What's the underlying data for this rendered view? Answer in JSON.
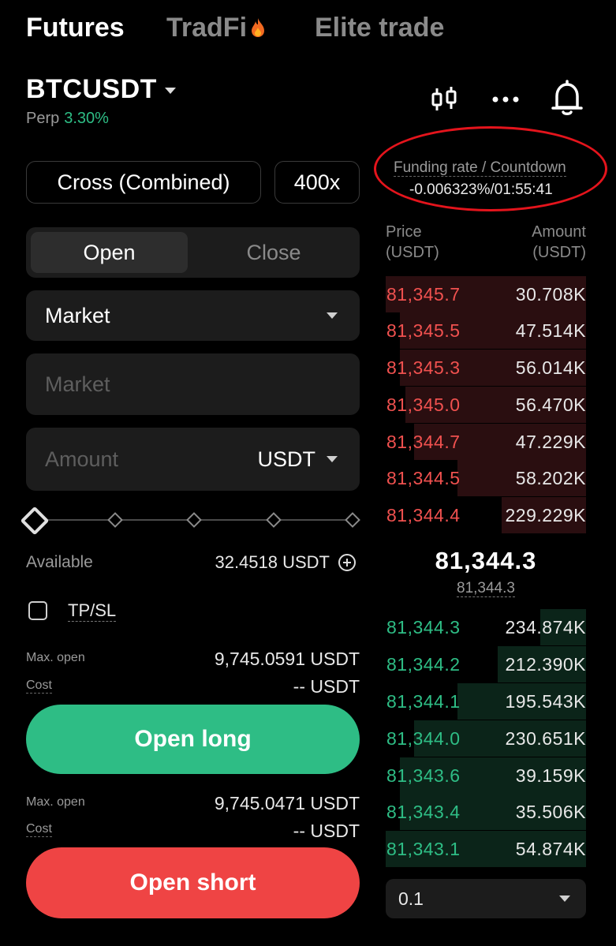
{
  "tabs": {
    "futures": "Futures",
    "tradfi": "TradFi",
    "elite": "Elite trade"
  },
  "header": {
    "symbol": "BTCUSDT",
    "perp_label": "Perp",
    "change": "3.30%"
  },
  "icons": {
    "chart": "candlestick-icon",
    "more": "more-icon",
    "bell": "bell-icon",
    "fire": "fire-icon"
  },
  "margin": {
    "mode": "Cross (Combined)",
    "leverage": "400x"
  },
  "funding": {
    "label": "Funding rate / Countdown",
    "value": "-0.006323%/01:55:41"
  },
  "order_tabs": {
    "open": "Open",
    "close": "Close"
  },
  "order_type": {
    "selected": "Market"
  },
  "price_field": {
    "placeholder": "Market"
  },
  "amount_field": {
    "placeholder": "Amount",
    "unit": "USDT"
  },
  "slider": {
    "fraction": 0
  },
  "available": {
    "label": "Available",
    "value": "32.4518 USDT"
  },
  "tpsl": {
    "label": "TP/SL",
    "checked": false
  },
  "long": {
    "max_label": "Max. open",
    "max_value": "9,745.0591 USDT",
    "cost_label": "Cost",
    "cost_value": "-- USDT",
    "button": "Open long"
  },
  "short": {
    "max_label": "Max. open",
    "max_value": "9,745.0471 USDT",
    "cost_label": "Cost",
    "cost_value": "-- USDT",
    "button": "Open short"
  },
  "orderbook": {
    "price_header": "Price",
    "price_unit": "(USDT)",
    "amount_header": "Amount",
    "amount_unit": "(USDT)",
    "asks": [
      {
        "price": "81,345.7",
        "amount": "30.708K",
        "depth": 1.0
      },
      {
        "price": "81,345.5",
        "amount": "47.514K",
        "depth": 0.93
      },
      {
        "price": "81,345.3",
        "amount": "56.014K",
        "depth": 0.93
      },
      {
        "price": "81,345.0",
        "amount": "56.470K",
        "depth": 0.9
      },
      {
        "price": "81,344.7",
        "amount": "47.229K",
        "depth": 0.86
      },
      {
        "price": "81,344.5",
        "amount": "58.202K",
        "depth": 0.64
      },
      {
        "price": "81,344.4",
        "amount": "229.229K",
        "depth": 0.42
      }
    ],
    "last_price": "81,344.3",
    "mark_price": "81,344.3",
    "bids": [
      {
        "price": "81,344.3",
        "amount": "234.874K",
        "depth": 0.23
      },
      {
        "price": "81,344.2",
        "amount": "212.390K",
        "depth": 0.44
      },
      {
        "price": "81,344.1",
        "amount": "195.543K",
        "depth": 0.64
      },
      {
        "price": "81,344.0",
        "amount": "230.651K",
        "depth": 0.86
      },
      {
        "price": "81,343.6",
        "amount": "39.159K",
        "depth": 0.93
      },
      {
        "price": "81,343.4",
        "amount": "35.506K",
        "depth": 0.93
      },
      {
        "price": "81,343.1",
        "amount": "54.874K",
        "depth": 1.0
      }
    ],
    "precision": "0.1"
  },
  "colors": {
    "buy": "#2ebd85",
    "sell": "#ef4444",
    "ask_text": "#f0514f",
    "annotation_ring": "#e4141c"
  }
}
